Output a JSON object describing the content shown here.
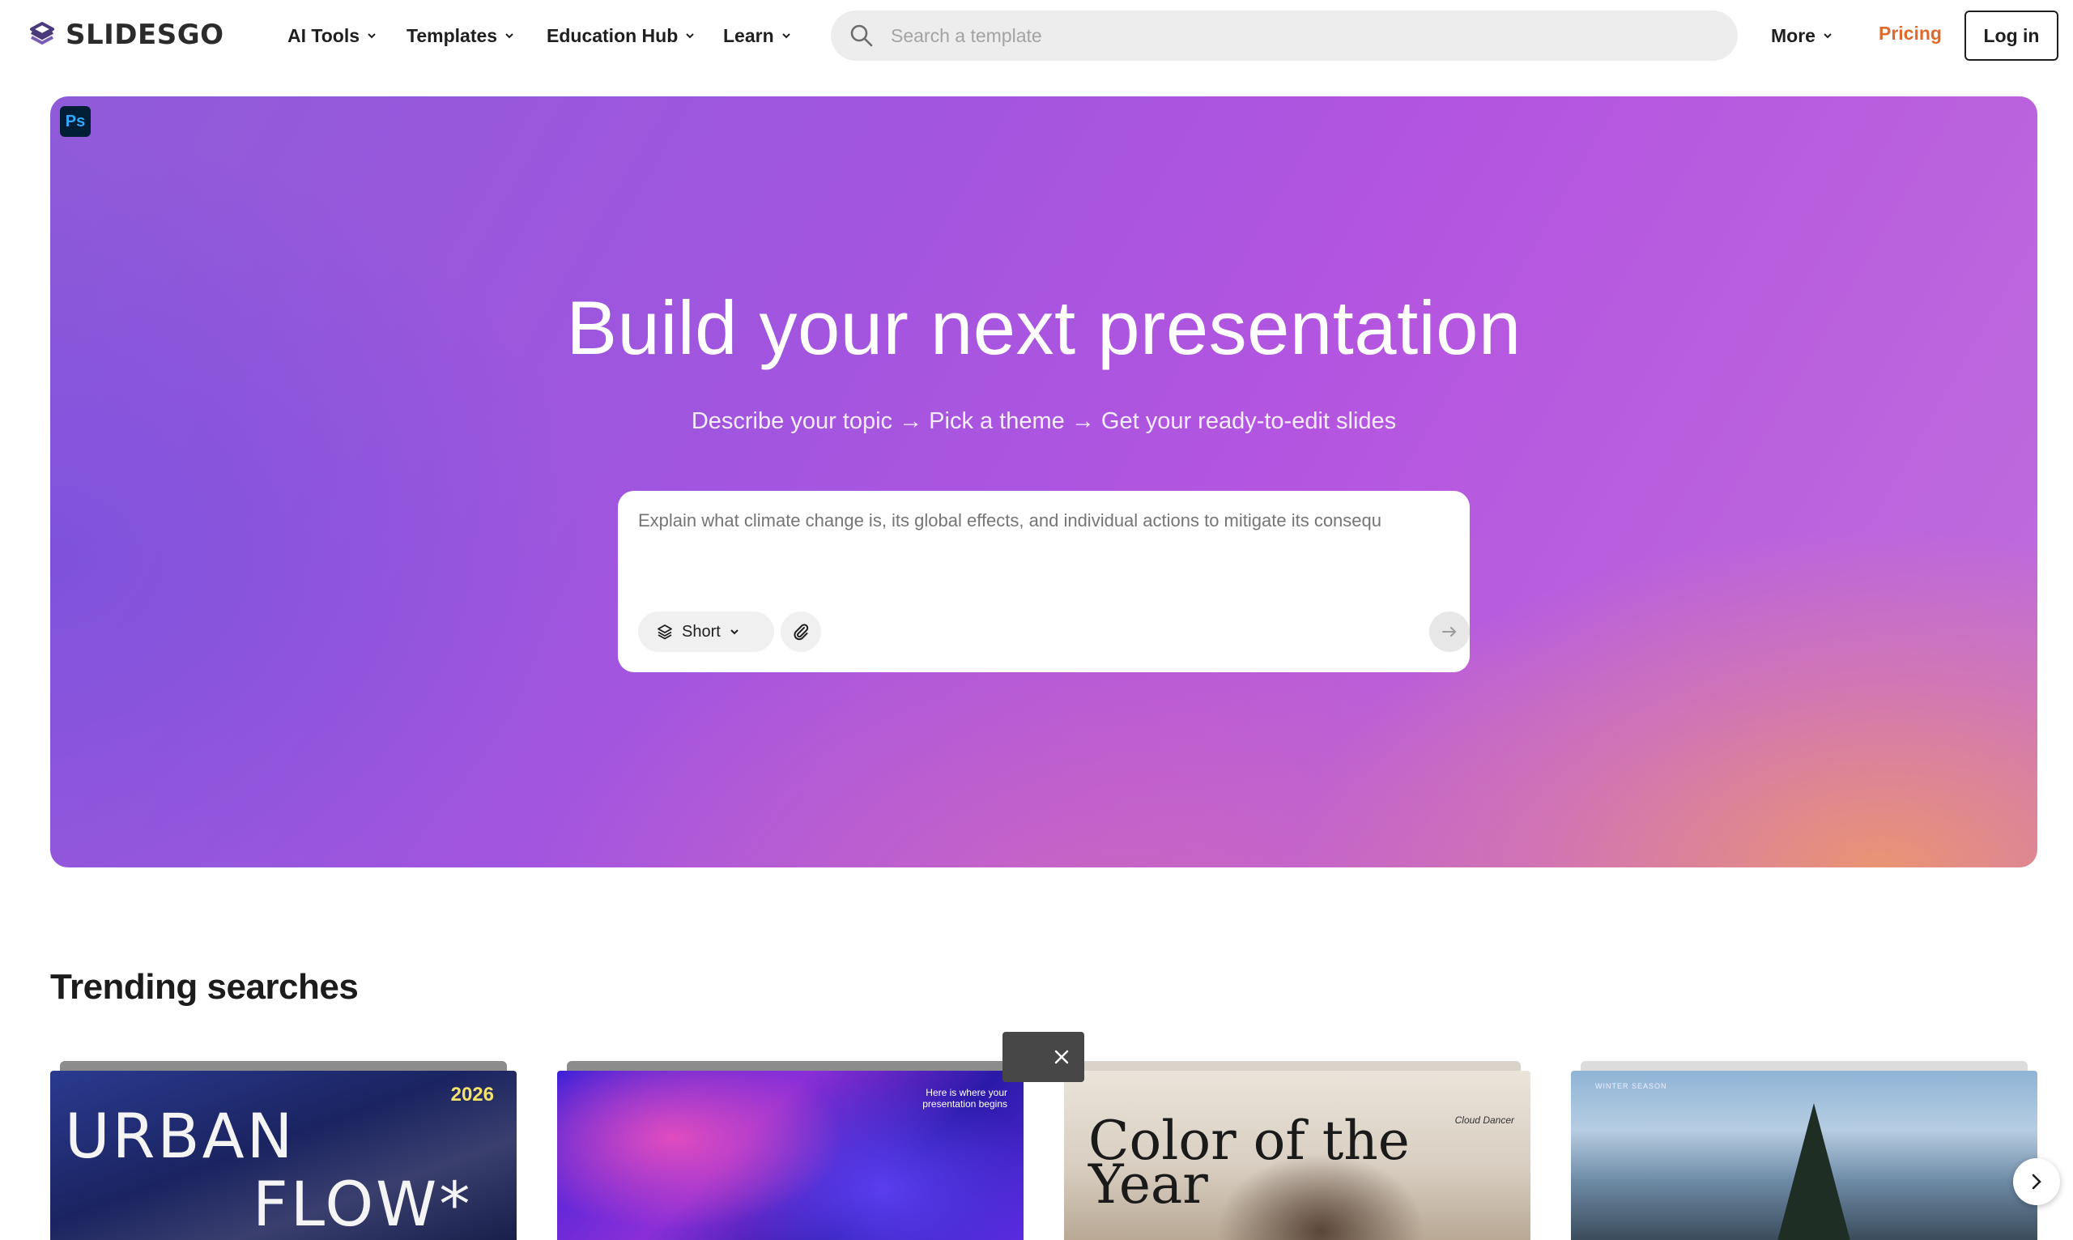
{
  "header": {
    "logo_text": "SLIDESGO",
    "nav": [
      {
        "label": "AI Tools"
      },
      {
        "label": "Templates"
      },
      {
        "label": "Education Hub"
      },
      {
        "label": "Learn"
      }
    ],
    "search": {
      "placeholder": "Search a template",
      "icon": "search-icon"
    },
    "more_label": "More",
    "pricing_label": "Pricing",
    "login_label": "Log in"
  },
  "hero": {
    "badge_text": "Ps",
    "title": "Build your next presentation",
    "subtitle": "Describe your topic → Pick a theme → Get your ready-to-edit slides",
    "prompt": {
      "placeholder": "Explain what climate change is, its global effects, and individual actions to mitigate its consequ",
      "length_label": "Short",
      "attach_icon": "paperclip-icon",
      "send_icon": "arrow-right-icon"
    }
  },
  "trending": {
    "title": "Trending searches",
    "cards": [
      {
        "line1": "URBAN",
        "line2": "FLOW*",
        "year": "2026"
      },
      {
        "text": "Here is where your presentation begins"
      },
      {
        "caption": "Cloud Dancer",
        "title": "Color of the Year"
      },
      {
        "caption": "WINTER SEASON"
      }
    ],
    "next_icon": "chevron-right-icon",
    "close_icon": "close-icon"
  },
  "colors": {
    "accent_pricing": "#e06a2b",
    "hero_purple": "#a155df",
    "hero_peach": "#ec966e"
  }
}
